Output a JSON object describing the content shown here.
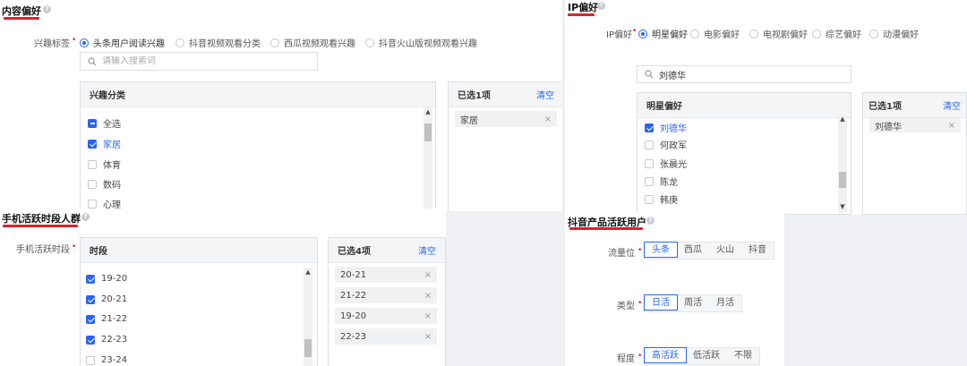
{
  "content_pref": {
    "title": "内容偏好",
    "field_label": "兴趣标签",
    "radio_options": [
      "头条用户阅读兴趣",
      "抖音视频观看分类",
      "西瓜视频观看兴趣",
      "抖音火山版视频观看兴趣"
    ],
    "search_placeholder": "请输入搜索词",
    "list_header": "兴趣分类",
    "items": [
      {
        "label": "全选",
        "state": "partial"
      },
      {
        "label": "家居",
        "state": "checked"
      },
      {
        "label": "体育",
        "state": "unchecked"
      },
      {
        "label": "数码",
        "state": "unchecked"
      },
      {
        "label": "心理",
        "state": "unchecked"
      }
    ],
    "selected_header": "已选1项",
    "clear_label": "清空",
    "selected_tags": [
      "家居"
    ],
    "close_glyph": "×"
  },
  "ip_pref": {
    "title": "IP偏好",
    "field_label": "IP偏好",
    "radio_options": [
      "明星偏好",
      "电影偏好",
      "电视剧偏好",
      "综艺偏好",
      "动漫偏好"
    ],
    "search_value": "刘德华",
    "list_header": "明星偏好",
    "items": [
      {
        "label": "刘德华",
        "state": "checked"
      },
      {
        "label": "何政军",
        "state": "unchecked"
      },
      {
        "label": "张晨光",
        "state": "unchecked"
      },
      {
        "label": "陈龙",
        "state": "unchecked"
      },
      {
        "label": "韩庚",
        "state": "unchecked"
      }
    ],
    "selected_header": "已选1项",
    "clear_label": "清空",
    "selected_tags": [
      "刘德华"
    ],
    "close_glyph": "×"
  },
  "active_time": {
    "title": "手机活跃时段人群",
    "field_label": "手机活跃时段",
    "list_header": "时段",
    "items": [
      {
        "label": "19-20",
        "state": "checked"
      },
      {
        "label": "20-21",
        "state": "checked"
      },
      {
        "label": "21-22",
        "state": "checked"
      },
      {
        "label": "22-23",
        "state": "checked"
      },
      {
        "label": "23-24",
        "state": "unchecked"
      }
    ],
    "selected_header": "已选4项",
    "clear_label": "清空",
    "selected_tags": [
      "20-21",
      "21-22",
      "19-20",
      "22-23"
    ],
    "close_glyph": "×"
  },
  "douyin_active": {
    "title": "抖音产品活跃用户",
    "rows": [
      {
        "label": "流量位",
        "options": [
          "头条",
          "西瓜",
          "火山",
          "抖音"
        ],
        "selected": 0
      },
      {
        "label": "类型",
        "options": [
          "日活",
          "周活",
          "月活"
        ],
        "selected": 0
      },
      {
        "label": "程度",
        "options": [
          "高活跃",
          "低活跃",
          "不限"
        ],
        "selected": 0
      }
    ]
  },
  "colors": {
    "accent": "#2a64f5",
    "title_underline": "#e0212b",
    "required": "#e0212b"
  },
  "icons": {
    "help": "?",
    "search": "search-icon",
    "scroll_up": "▲",
    "scroll_down": "▼"
  }
}
